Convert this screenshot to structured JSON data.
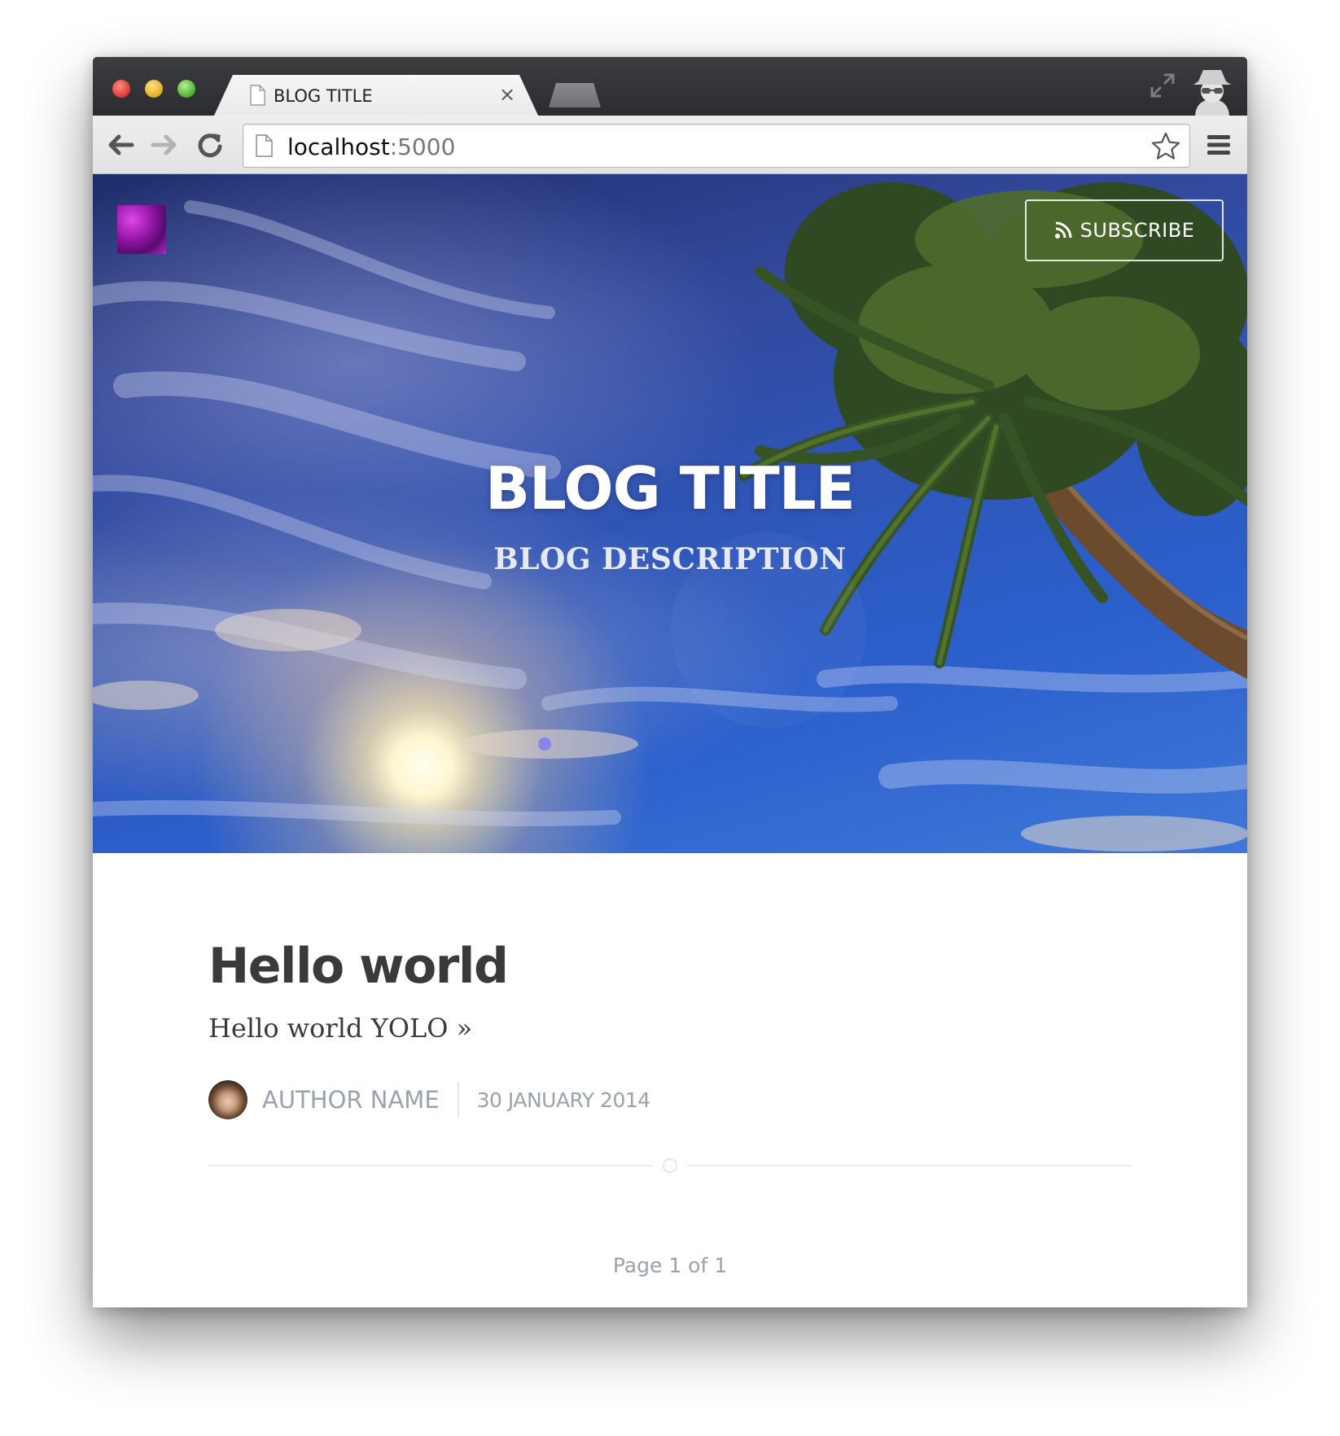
{
  "browser": {
    "tab_title": "BLOG TITLE",
    "tab_close_glyph": "×",
    "url_host": "localhost",
    "url_port": ":5000",
    "icons": {
      "close": "close-icon",
      "back": "back-arrow-icon",
      "forward": "forward-arrow-icon",
      "reload": "reload-icon",
      "page": "page-icon",
      "star": "star-icon",
      "menu": "hamburger-menu-icon",
      "fullscreen": "fullscreen-icon",
      "incognito": "incognito-icon"
    }
  },
  "header": {
    "subscribe_label": "SUBSCRIBE",
    "subscribe_icon": "rss-icon",
    "blog_title": "BLOG TITLE",
    "blog_description": "BLOG DESCRIPTION"
  },
  "post": {
    "title": "Hello world",
    "excerpt": "Hello world YOLO",
    "more_glyph": "»",
    "author_name": "AUTHOR NAME",
    "date": "30 JANUARY 2014"
  },
  "pagination": {
    "text": "Page 1 of 1"
  },
  "colors": {
    "meta_gray": "#9aa3ad",
    "heading": "#3a3a3a",
    "sky_blue": "#2f56b8"
  }
}
